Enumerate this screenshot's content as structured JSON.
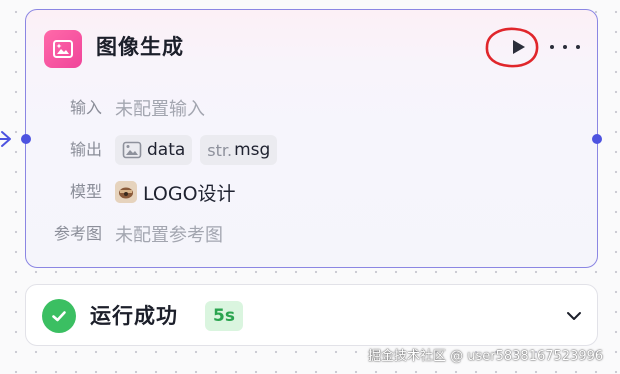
{
  "node": {
    "title": "图像生成",
    "icon": "image-sparkle-icon",
    "accent_color": "#f0449a",
    "border_color": "#8b86e3",
    "actions": {
      "run": "play-icon",
      "more": "more-horizontal-icon"
    },
    "fields": {
      "input": {
        "label": "输入",
        "value": "未配置输入"
      },
      "output": {
        "label": "输出",
        "tags": [
          {
            "icon": "image-icon",
            "text": "data"
          },
          {
            "prefix": "str.",
            "text": "msg"
          }
        ]
      },
      "model": {
        "label": "模型",
        "value": "LOGO设计",
        "icon": "model-avatar"
      },
      "reference": {
        "label": "参考图",
        "value": "未配置参考图"
      }
    }
  },
  "status": {
    "text": "运行成功",
    "duration": "5s",
    "color": "#3bbf62"
  },
  "watermark": "掘金技术社区 @ user5838167523996"
}
